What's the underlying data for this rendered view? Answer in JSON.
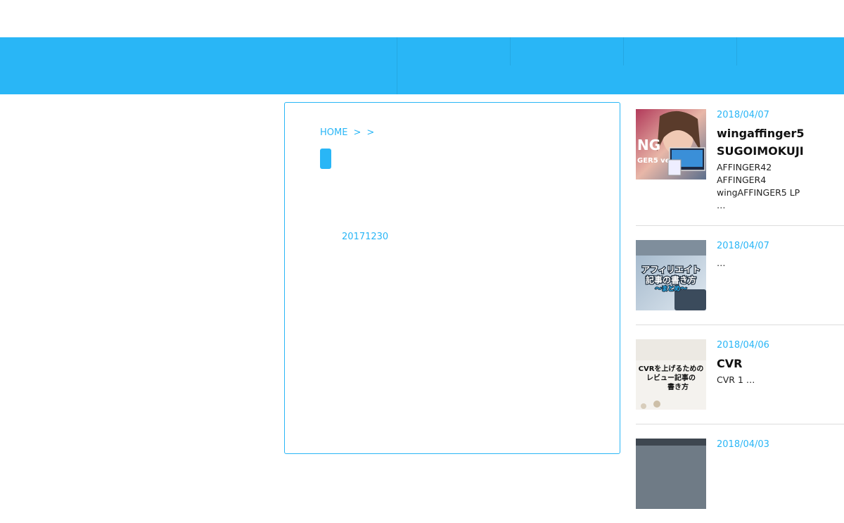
{
  "breadcrumb": {
    "home": "HOME",
    "sep1": ">",
    "sep2": ">"
  },
  "post": {
    "date": "20171230"
  },
  "sidebar": {
    "items": [
      {
        "date": "2018/04/07",
        "title": "wingaffinger5 SUGOIMOKUJI",
        "excerpt": "AFFINGER42\nAFFINGER4\nwingAFFINGER5 LP\n …",
        "thumb_text": "NG\nGER5 ver"
      },
      {
        "date": "2018/04/07",
        "title": "",
        "excerpt": " …",
        "thumb_text": "アフィリエイト\n記事の書き方\n〜まとめ〜"
      },
      {
        "date": "2018/04/06",
        "title": "CVR",
        "excerpt": " CVR 1 …",
        "thumb_text": "CVRを上げるための\nレビュー記事の\n書き方"
      },
      {
        "date": "2018/04/03",
        "title": "",
        "excerpt": "",
        "thumb_text": ""
      }
    ]
  },
  "colors": {
    "accent": "#29b6f6",
    "border": "#dddddd"
  }
}
